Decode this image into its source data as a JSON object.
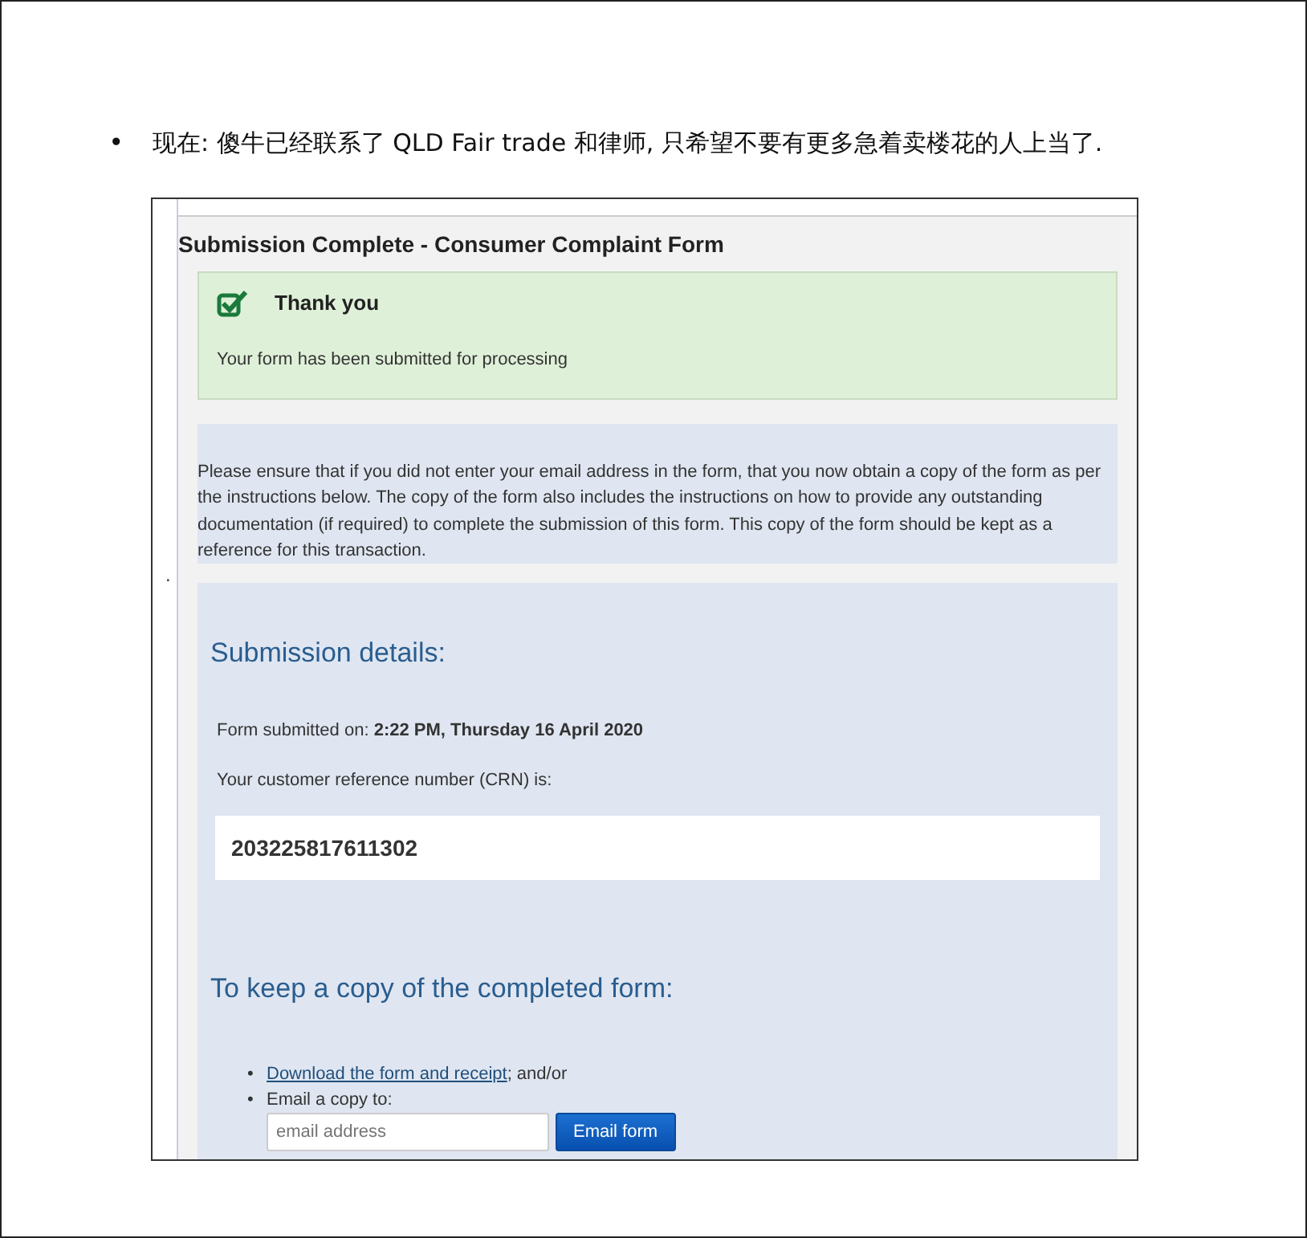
{
  "document": {
    "bullet": "•",
    "text": "现在: 傻牛已经联系了 QLD Fair trade 和律师, 只希望不要有更多急着卖楼花的人上当了.",
    "stray_mark": "."
  },
  "screenshot": {
    "title": "Submission Complete - Consumer Complaint Form",
    "success": {
      "heading": "Thank you",
      "message": "Your form has been submitted for processing"
    },
    "notice": "Please ensure that if you did not enter your email address in the form, that you now obtain a copy of the form as per the instructions below. The copy of the form also includes the instructions on how to provide any outstanding documentation (if required) to complete the submission of this form. This copy of the form should be kept as a reference for this transaction.",
    "details": {
      "heading": "Submission details:",
      "submitted_label": "Form submitted on:",
      "submitted_value": "2:22 PM, Thursday 16 April 2020",
      "crn_label": "Your customer reference number (CRN) is:",
      "crn": "203225817611302"
    },
    "copy": {
      "heading": "To keep a copy of the completed form:",
      "items": [
        {
          "kind": "link",
          "marker": "•",
          "link": "Download the form and receipt",
          "text": "; and/or"
        },
        {
          "kind": "email",
          "marker": "•",
          "text": "Email a copy to:",
          "placeholder": "email address",
          "button": "Email form"
        }
      ]
    }
  }
}
